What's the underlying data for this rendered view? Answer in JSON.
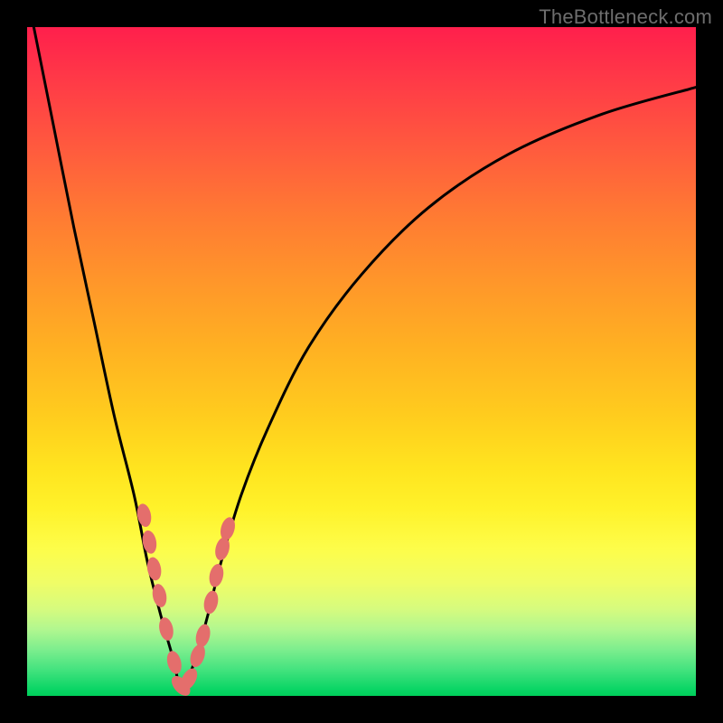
{
  "watermark": "TheBottleneck.com",
  "colors": {
    "frame": "#000000",
    "curve": "#000000",
    "marker_fill": "#e46e6c",
    "watermark": "#6d6d6d"
  },
  "chart_data": {
    "type": "line",
    "title": "",
    "xlabel": "",
    "ylabel": "",
    "xlim": [
      0,
      100
    ],
    "ylim": [
      0,
      100
    ],
    "note": "Bottleneck-calculator V-shaped curve with minimum near x≈23. Y is bottleneck % (red=high, green=low). No numeric axis labels shown; values below are estimates from pixel positions.",
    "series": [
      {
        "name": "bottleneck_curve",
        "x": [
          1,
          4,
          7,
          10,
          13,
          16,
          18,
          20,
          22,
          23,
          25,
          27,
          29,
          32,
          36,
          42,
          50,
          60,
          72,
          86,
          100
        ],
        "y": [
          100,
          85,
          70,
          56,
          42,
          30,
          20,
          12,
          5,
          1,
          5,
          12,
          20,
          30,
          40,
          52,
          63,
          73,
          81,
          87,
          91
        ]
      }
    ],
    "markers": {
      "name": "highlighted_points",
      "comment": "Salmon ovals clustered on both arms of the V near the trough",
      "points": [
        {
          "x": 17.5,
          "y": 27
        },
        {
          "x": 18.3,
          "y": 23
        },
        {
          "x": 19.0,
          "y": 19
        },
        {
          "x": 19.8,
          "y": 15
        },
        {
          "x": 20.8,
          "y": 10
        },
        {
          "x": 22.0,
          "y": 5
        },
        {
          "x": 23.0,
          "y": 1.5
        },
        {
          "x": 24.2,
          "y": 2.5
        },
        {
          "x": 25.5,
          "y": 6
        },
        {
          "x": 26.3,
          "y": 9
        },
        {
          "x": 27.5,
          "y": 14
        },
        {
          "x": 28.3,
          "y": 18
        },
        {
          "x": 29.2,
          "y": 22
        },
        {
          "x": 30.0,
          "y": 25
        }
      ]
    }
  }
}
